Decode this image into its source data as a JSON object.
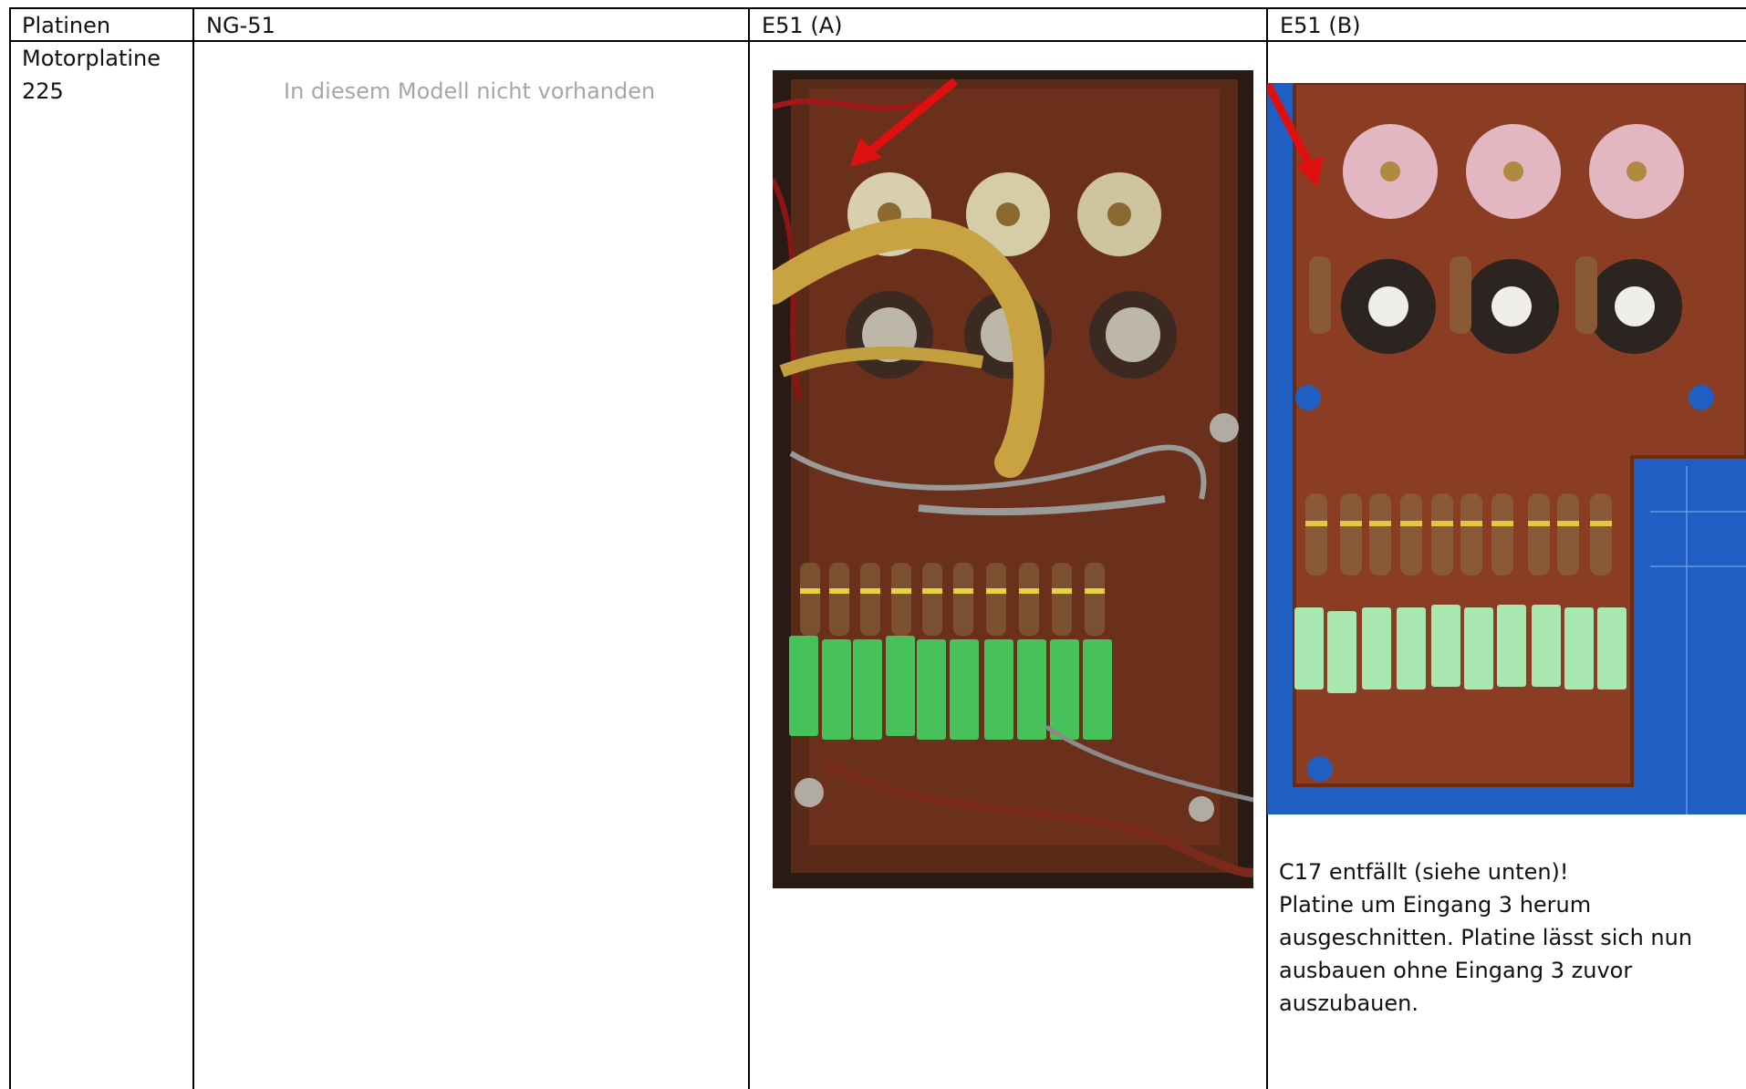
{
  "table": {
    "headers": [
      "Platinen",
      "NG-51",
      "E51 (A)",
      "E51 (B)"
    ],
    "row_label_line1": "Motorplatine",
    "row_label_line2": "225",
    "ng51_text": "In diesem Modell nicht vorhanden",
    "note_lines": [
      "C17 entfällt (siehe unten)!",
      "Platine um Eingang 3 herum",
      "ausgeschnitten. Platine lässt sich nun",
      "ausbauen ohne Eingang 3 zuvor",
      "auszubauen."
    ]
  },
  "images": {
    "photo_a": "circuit-board-photo-e51a",
    "photo_b": "circuit-board-photo-e51b",
    "arrow_color": "#e01010"
  }
}
